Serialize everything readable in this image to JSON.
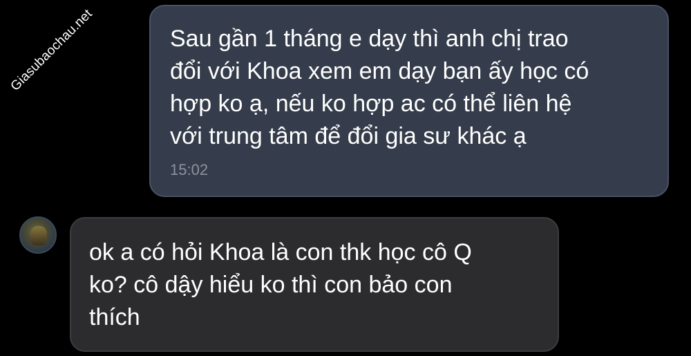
{
  "watermark": "Giasubaochau.net",
  "messages": [
    {
      "direction": "outgoing",
      "text": "Sau gần 1 tháng e dạy thì anh chị trao\nđổi với Khoa xem em dạy bạn ấy học có\nhợp ko ạ, nếu ko hợp ac có thể liên hệ\nvới trung tâm để đổi gia sư khác ạ",
      "time": "15:02"
    },
    {
      "direction": "incoming",
      "text": "ok a có hỏi Khoa là con thk học cô Q\nko? cô dậy hiểu ko thì con bảo con\nthích"
    }
  ],
  "colors": {
    "background": "#000000",
    "outgoing_bubble": "#353c4b",
    "incoming_bubble": "#2c2c2e",
    "timestamp": "#8d93a0"
  }
}
